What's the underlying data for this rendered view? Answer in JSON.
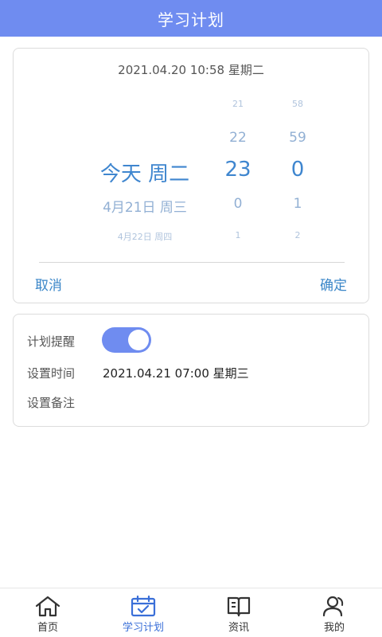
{
  "header": {
    "title": "学习计划"
  },
  "picker": {
    "current_datetime": "2021.04.20 10:58 星期二",
    "date_column": [
      "",
      "",
      "今天 周二",
      "4月21日 周三",
      "4月22日 周四"
    ],
    "hour_column": [
      "21",
      "22",
      "23",
      "0",
      "1"
    ],
    "minute_column": [
      "58",
      "59",
      "0",
      "1",
      "2"
    ],
    "cancel_label": "取消",
    "confirm_label": "确定"
  },
  "settings": {
    "reminder_label": "计划提醒",
    "reminder_enabled": true,
    "time_label": "设置时间",
    "time_value": "2021.04.21 07:00 星期三",
    "note_label": "设置备注"
  },
  "tabbar": {
    "active_index": 1,
    "items": [
      {
        "label": "首页",
        "icon": "home-icon"
      },
      {
        "label": "学习计划",
        "icon": "calendar-check-icon"
      },
      {
        "label": "资讯",
        "icon": "book-icon"
      },
      {
        "label": "我的",
        "icon": "user-icon"
      }
    ]
  },
  "colors": {
    "accent": "#6f8cf0",
    "picker_selected": "#3f86cf",
    "action_text": "#3a86c8"
  }
}
